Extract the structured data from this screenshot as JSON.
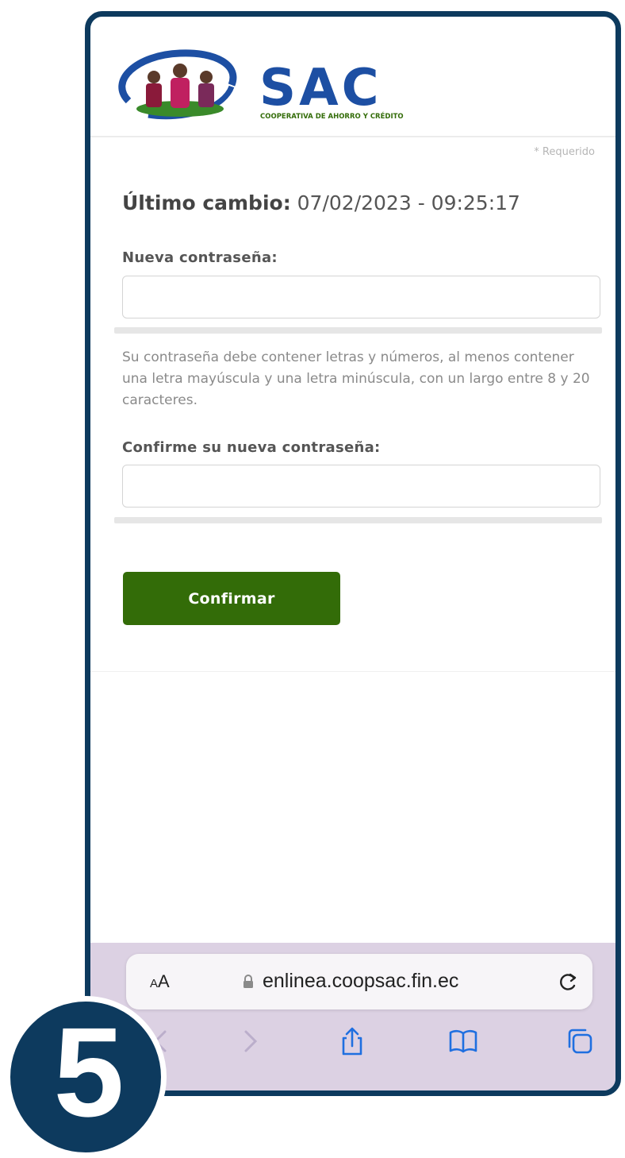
{
  "brand": {
    "name": "SAC",
    "tagline": "COOPERATIVA DE AHORRO Y CRÉDITO",
    "colors": {
      "navy": "#0d3a5e",
      "blue": "#1d4fa3",
      "green": "#336c08"
    }
  },
  "form": {
    "required_note": "* Requerido",
    "last_change_label": "Último cambio:",
    "last_change_value": "07/02/2023 - 09:25:17",
    "new_password_label": "Nueva contraseña:",
    "new_password_value": "",
    "password_hint": "Su contraseña debe contener letras y números, al menos contener una letra mayúscula y una letra minúscula, con un largo entre 8 y 20 caracteres.",
    "confirm_password_label": "Confirme su nueva contraseña:",
    "confirm_password_value": "",
    "confirm_button": "Confirmar"
  },
  "browser": {
    "text_size_a_small": "A",
    "text_size_a_large": "A",
    "url": "enlinea.coopsac.fin.ec",
    "icons": [
      "text-size-icon",
      "lock-icon",
      "reload-icon",
      "back-icon",
      "forward-icon",
      "share-icon",
      "bookmarks-icon",
      "tabs-icon"
    ]
  },
  "step": {
    "number": "5"
  }
}
